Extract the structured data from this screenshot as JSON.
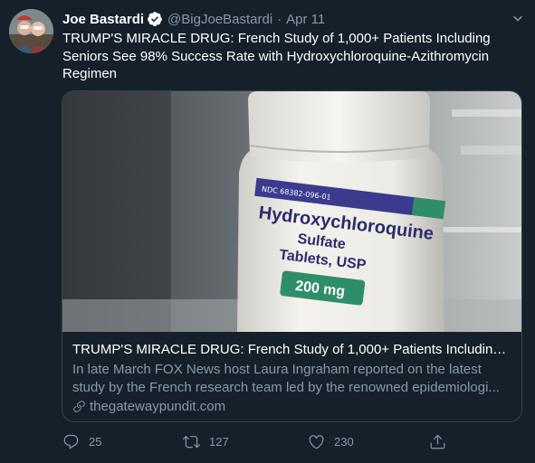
{
  "user": {
    "name": "Joe Bastardi",
    "handle": "@BigJoeBastardi",
    "separator": "·",
    "date": "Apr 11"
  },
  "tweet": {
    "text": "TRUMP'S MIRACLE DRUG: French Study of 1,000+ Patients Including Seniors See 98% Success Rate with Hydroxychloroquine-Azithromycin Regimen"
  },
  "card": {
    "image_label": {
      "ndc": "NDC 68382-096-01",
      "drug": "Hydroxychloroquine",
      "form_line1": "Sulfate",
      "form_line2": "Tablets, USP",
      "dose": "200 mg"
    },
    "title": "TRUMP'S MIRACLE DRUG: French Study of 1,000+ Patients Including...",
    "description_line1": "In late March FOX News host Laura Ingraham reported on the latest",
    "description_line2": "study by the French research team led by the renowned epidemiologi...",
    "domain": "thegatewaypundit.com"
  },
  "actions": {
    "replies": "25",
    "retweets": "127",
    "likes": "230"
  },
  "colors": {
    "background": "#15202b",
    "secondary_text": "#8899a6",
    "verified_blue": "#1da1f2",
    "border": "#38444d"
  }
}
